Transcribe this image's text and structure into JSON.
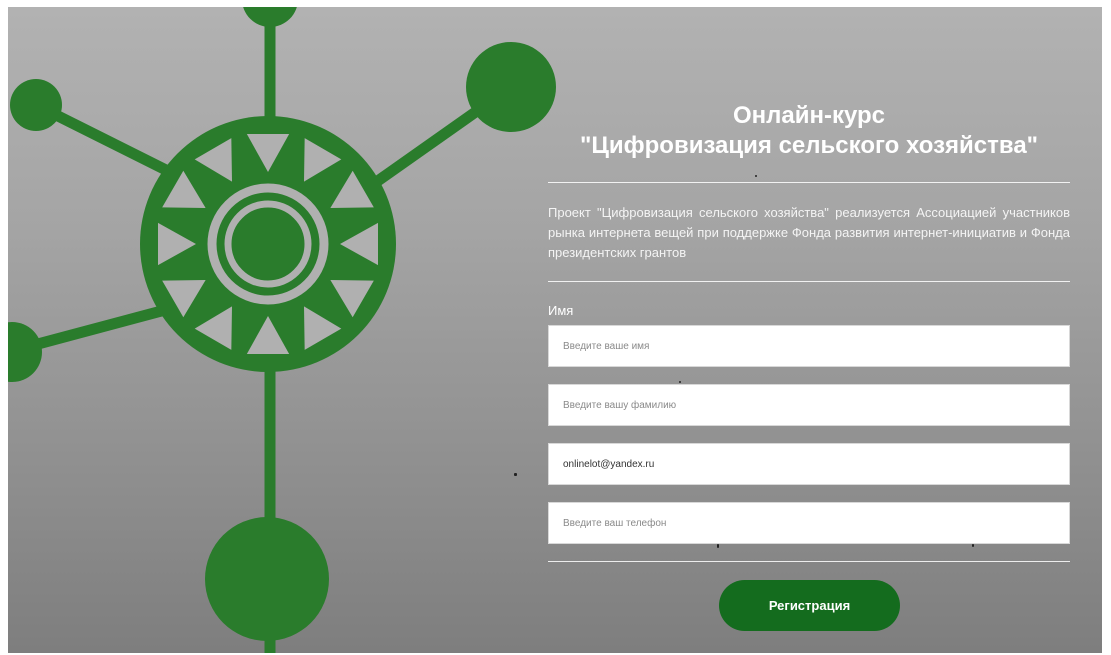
{
  "title": {
    "line1": "Онлайн-курс",
    "line2": "\"Цифровизация сельского хозяйства\""
  },
  "description": "Проект \"Цифровизация сельского хозяйства\" реализуется Ассоциацией участников рынка интернета вещей при поддержке Фонда развития интернет-инициатив и Фонда президентских грантов",
  "form": {
    "name_label": "Имя",
    "first_name": {
      "placeholder": "Введите ваше имя",
      "value": ""
    },
    "last_name": {
      "placeholder": "Введите вашу фамилию",
      "value": ""
    },
    "email": {
      "placeholder": "",
      "value": "onlinelot@yandex.ru"
    },
    "phone": {
      "placeholder": "Введите ваш телефон",
      "value": ""
    },
    "submit_label": "Регистрация"
  },
  "colors": {
    "emblem_green": "#2a7c2c",
    "button_green": "#146c1e",
    "background_gray": "#a0a0a0"
  }
}
